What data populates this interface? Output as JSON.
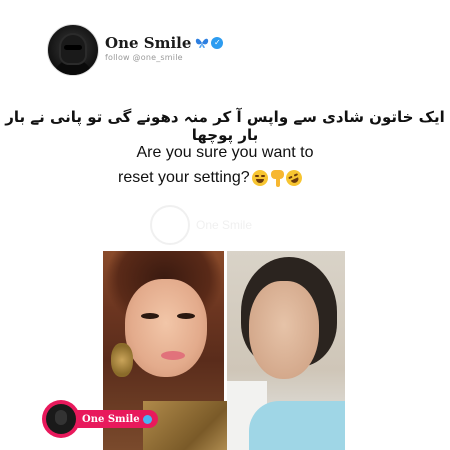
{
  "header": {
    "account_name": "One Smile",
    "handle": "follow @one_smile",
    "icons": [
      "butterfly-icon",
      "verified-icon"
    ],
    "verified_color": "#2d9cf0"
  },
  "post": {
    "urdu_line": "ایک خاتون شادی سے واپس آ کر منہ دھونے گی تو پانی نے بار بار پوچھا",
    "english_line_1": "Are you sure you want to",
    "english_line_2": "reset your setting?",
    "emojis": [
      "laughing-emoji",
      "pointing-down-emoji",
      "rolling-laughing-emoji"
    ]
  },
  "watermark": {
    "text": "One Smile"
  },
  "image": {
    "description_icons": [
      "before-makeup-photo",
      "after-makeup-photo"
    ]
  },
  "badge": {
    "name": "One Smile",
    "accent_color": "#e8195c"
  }
}
